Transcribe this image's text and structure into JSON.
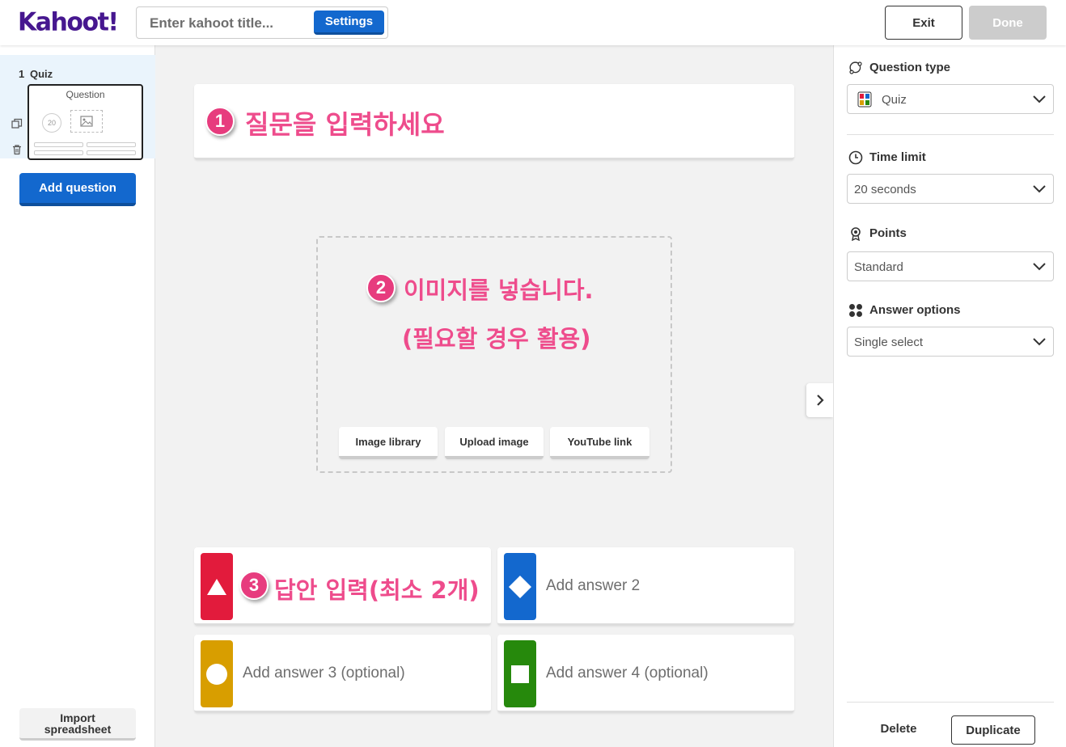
{
  "header": {
    "logo_text": "Kahoot!",
    "title_placeholder": "Enter kahoot title...",
    "settings_label": "Settings",
    "exit_label": "Exit",
    "done_label": "Done"
  },
  "sidebar": {
    "slide": {
      "number": "1",
      "type": "Quiz",
      "thumb_title": "Question",
      "thumb_timer": "20"
    },
    "add_question_label": "Add question",
    "import_label_line1": "Import",
    "import_label_line2": "spreadsheet"
  },
  "canvas": {
    "annotations": {
      "step1_badge": "1",
      "step1_text": "질문을 입력하세요",
      "step2_badge": "2",
      "step2_text": "이미지를 넣습니다.",
      "step2_subtext": "(필요할 경우 활용)",
      "step3_badge": "3",
      "step3_text": "답안 입력(최소 2개)"
    },
    "media_buttons": [
      "Image library",
      "Upload image",
      "YouTube link"
    ],
    "answers": [
      {
        "placeholder": "",
        "shape": "triangle",
        "color": "#e21b3c"
      },
      {
        "placeholder": "Add answer 2",
        "shape": "diamond",
        "color": "#1368ce"
      },
      {
        "placeholder": "Add answer 3 (optional)",
        "shape": "circle",
        "color": "#d89e00"
      },
      {
        "placeholder": "Add answer 4 (optional)",
        "shape": "square",
        "color": "#26890c"
      }
    ]
  },
  "right_panel": {
    "question_type": {
      "label": "Question type",
      "value": "Quiz",
      "icon": "question-type-icon"
    },
    "time_limit": {
      "label": "Time limit",
      "value": "20 seconds",
      "icon": "clock-icon"
    },
    "points": {
      "label": "Points",
      "value": "Standard",
      "icon": "medal-icon"
    },
    "answer_options": {
      "label": "Answer options",
      "value": "Single select",
      "icon": "dots-grid-icon"
    },
    "delete_label": "Delete",
    "duplicate_label": "Duplicate"
  },
  "colors": {
    "primary_blue": "#1368ce",
    "brand_purple": "#46178f",
    "annotation_pink": "#ee4c8c",
    "red": "#e21b3c",
    "blue": "#1368ce",
    "yellow": "#d89e00",
    "green": "#26890c"
  }
}
